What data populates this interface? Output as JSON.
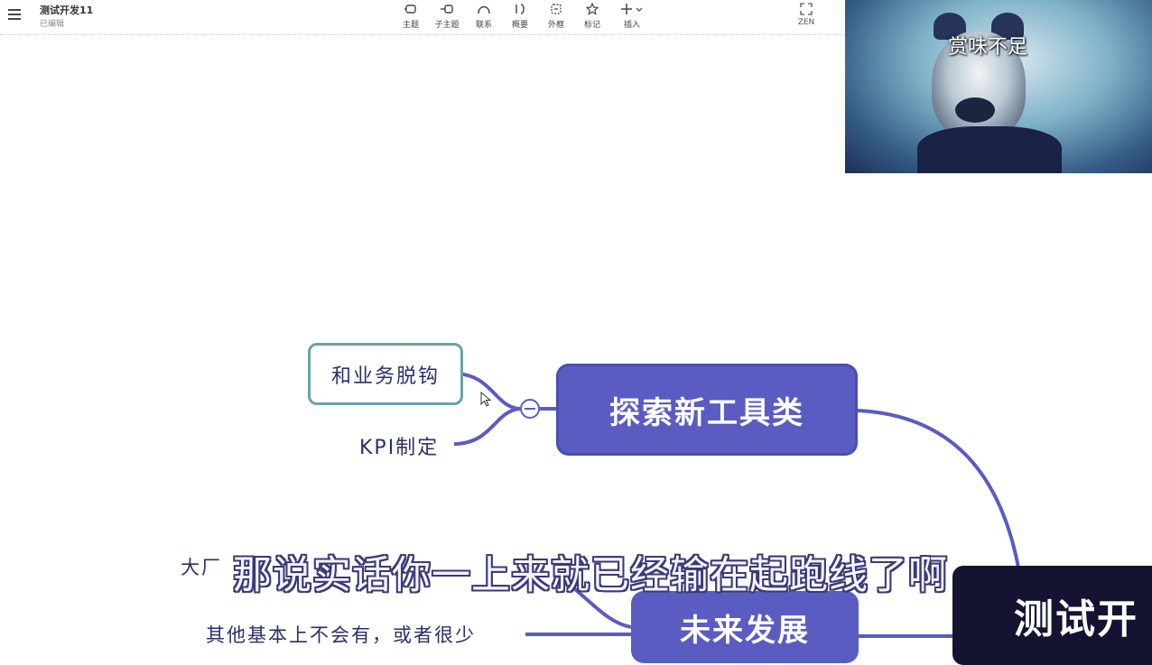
{
  "header": {
    "title": "测试开发11",
    "status": "已编辑"
  },
  "toolbar": {
    "items": [
      {
        "label": "主题",
        "icon": "topic-icon"
      },
      {
        "label": "子主题",
        "icon": "subtopic-icon"
      },
      {
        "label": "联系",
        "icon": "relationship-icon"
      },
      {
        "label": "概要",
        "icon": "summary-icon"
      },
      {
        "label": "外框",
        "icon": "boundary-icon"
      },
      {
        "label": "标记",
        "icon": "star-icon"
      },
      {
        "label": "插入",
        "icon": "plus-icon"
      }
    ],
    "zen_label": "ZEN"
  },
  "webcam": {
    "caption": "赏味不足"
  },
  "mindmap": {
    "root_label": "测试开",
    "explore_label": "探索新工具类",
    "future_label": "未来发展",
    "subtopics": {
      "decouple": "和业务脱钩",
      "kpi": "KPI制定",
      "bigco": "大厂",
      "other": "其他基本上不会有，或者很少"
    }
  },
  "subtitle": "那说实话你一上来就已经输在起跑线了啊",
  "colors": {
    "topic": "#5a5cc2",
    "root": "#141432",
    "selection": "#6aa2a8",
    "connector": "#5a5cc2"
  }
}
